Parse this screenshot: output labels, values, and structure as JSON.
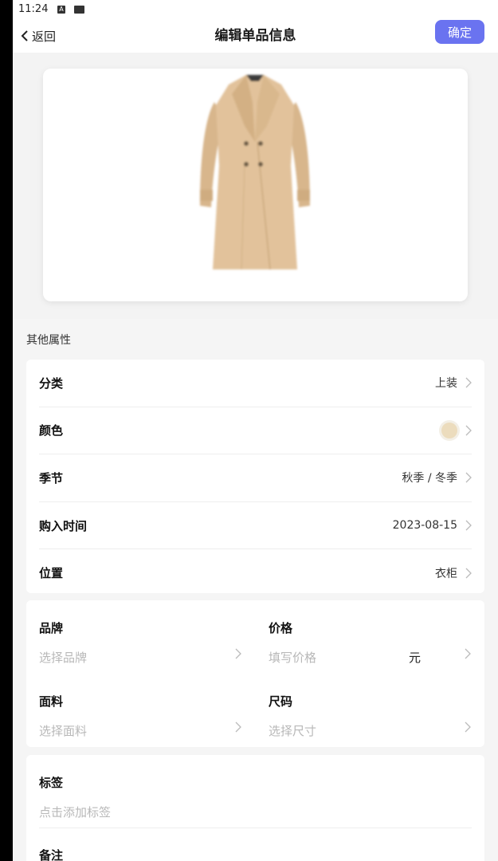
{
  "status_bar": {
    "time": "11:24",
    "icon_a": "A"
  },
  "nav": {
    "back_label": "返回",
    "title": "编辑单品信息",
    "confirm_label": "确定"
  },
  "sections": {
    "other_attributes": "其他属性"
  },
  "attributes": [
    {
      "label": "分类",
      "value": "上装"
    },
    {
      "label": "颜色",
      "value": "",
      "swatch_color": "#ecdcbd"
    },
    {
      "label": "季节",
      "value": "秋季 / 冬季"
    },
    {
      "label": "购入时间",
      "value": "2023-08-15"
    },
    {
      "label": "位置",
      "value": "衣柜"
    }
  ],
  "details": {
    "brand": {
      "label": "品牌",
      "placeholder": "选择品牌"
    },
    "price": {
      "label": "价格",
      "placeholder": "填写价格",
      "unit": "元"
    },
    "fabric": {
      "label": "面料",
      "placeholder": "选择面料"
    },
    "size": {
      "label": "尺码",
      "placeholder": "选择尺寸"
    }
  },
  "tags": {
    "label": "标签",
    "placeholder": "点击添加标签"
  },
  "notes": {
    "label": "备注"
  },
  "colors": {
    "accent": "#6a73f0",
    "coat": "#e2c29b"
  }
}
